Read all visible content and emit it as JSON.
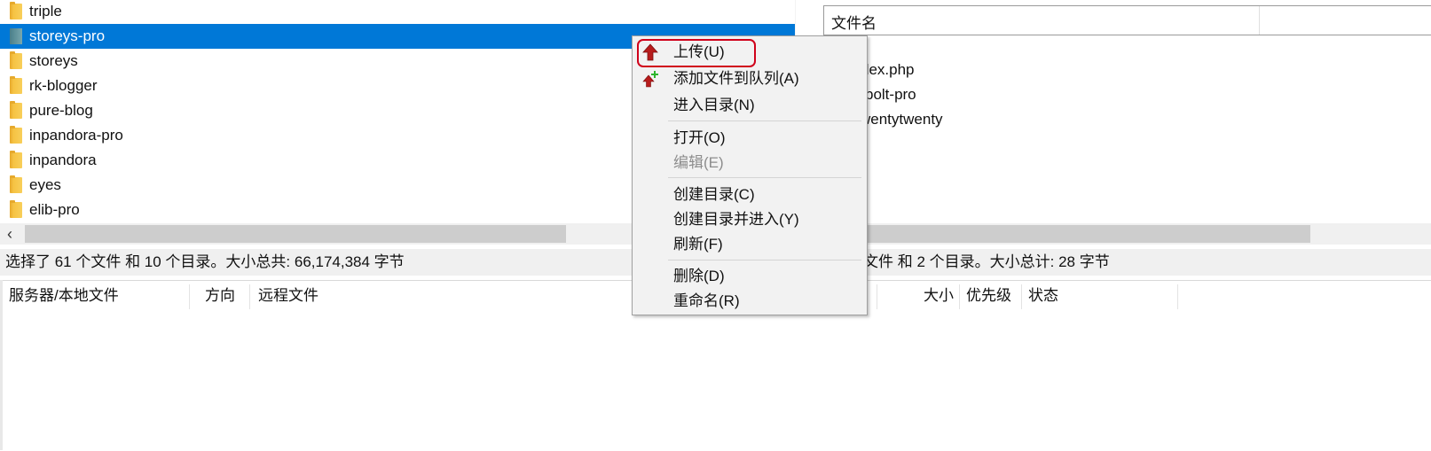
{
  "local": {
    "folders": [
      {
        "name": "triple",
        "selected": false
      },
      {
        "name": "storeys-pro",
        "selected": true
      },
      {
        "name": "storeys",
        "selected": false
      },
      {
        "name": "rk-blogger",
        "selected": false
      },
      {
        "name": "pure-blog",
        "selected": false
      },
      {
        "name": "inpandora-pro",
        "selected": false
      },
      {
        "name": "inpandora",
        "selected": false
      },
      {
        "name": "eyes",
        "selected": false
      },
      {
        "name": "elib-pro",
        "selected": false
      }
    ],
    "status": "选择了 61 个文件 和 10 个目录。大小总共: 66,174,384 字节",
    "scroll_left_icon": "chevron-left-icon"
  },
  "remote": {
    "header_filename": "文件名",
    "files": [
      "index.php",
      "bolt-pro",
      "twentytwenty"
    ],
    "files_visible": [
      "dex.php",
      "bolt-pro",
      "wentytwenty"
    ],
    "status_visible": "文件 和 2 个目录。大小总计: 28 字节"
  },
  "queue": {
    "columns": {
      "server_local": "服务器/本地文件",
      "direction": "方向",
      "remote_file": "远程文件",
      "size": "大小",
      "priority": "优先级",
      "status": "状态"
    }
  },
  "context_menu": {
    "items": [
      {
        "label": "上传(U)",
        "icon": "upload-arrow-icon",
        "highlighted": true
      },
      {
        "label": "添加文件到队列(A)",
        "icon": "add-to-queue-icon"
      },
      {
        "label": "进入目录(N)"
      },
      {
        "label": "打开(O)"
      },
      {
        "label": "编辑(E)",
        "disabled": true
      },
      {
        "label": "创建目录(C)"
      },
      {
        "label": "创建目录并进入(Y)"
      },
      {
        "label": "刷新(F)"
      },
      {
        "label": "删除(D)"
      },
      {
        "label": "重命名(R)"
      }
    ],
    "highlight_color": "#d0021b"
  },
  "colors": {
    "selection": "#0078d7",
    "folder": "#f6c343"
  }
}
